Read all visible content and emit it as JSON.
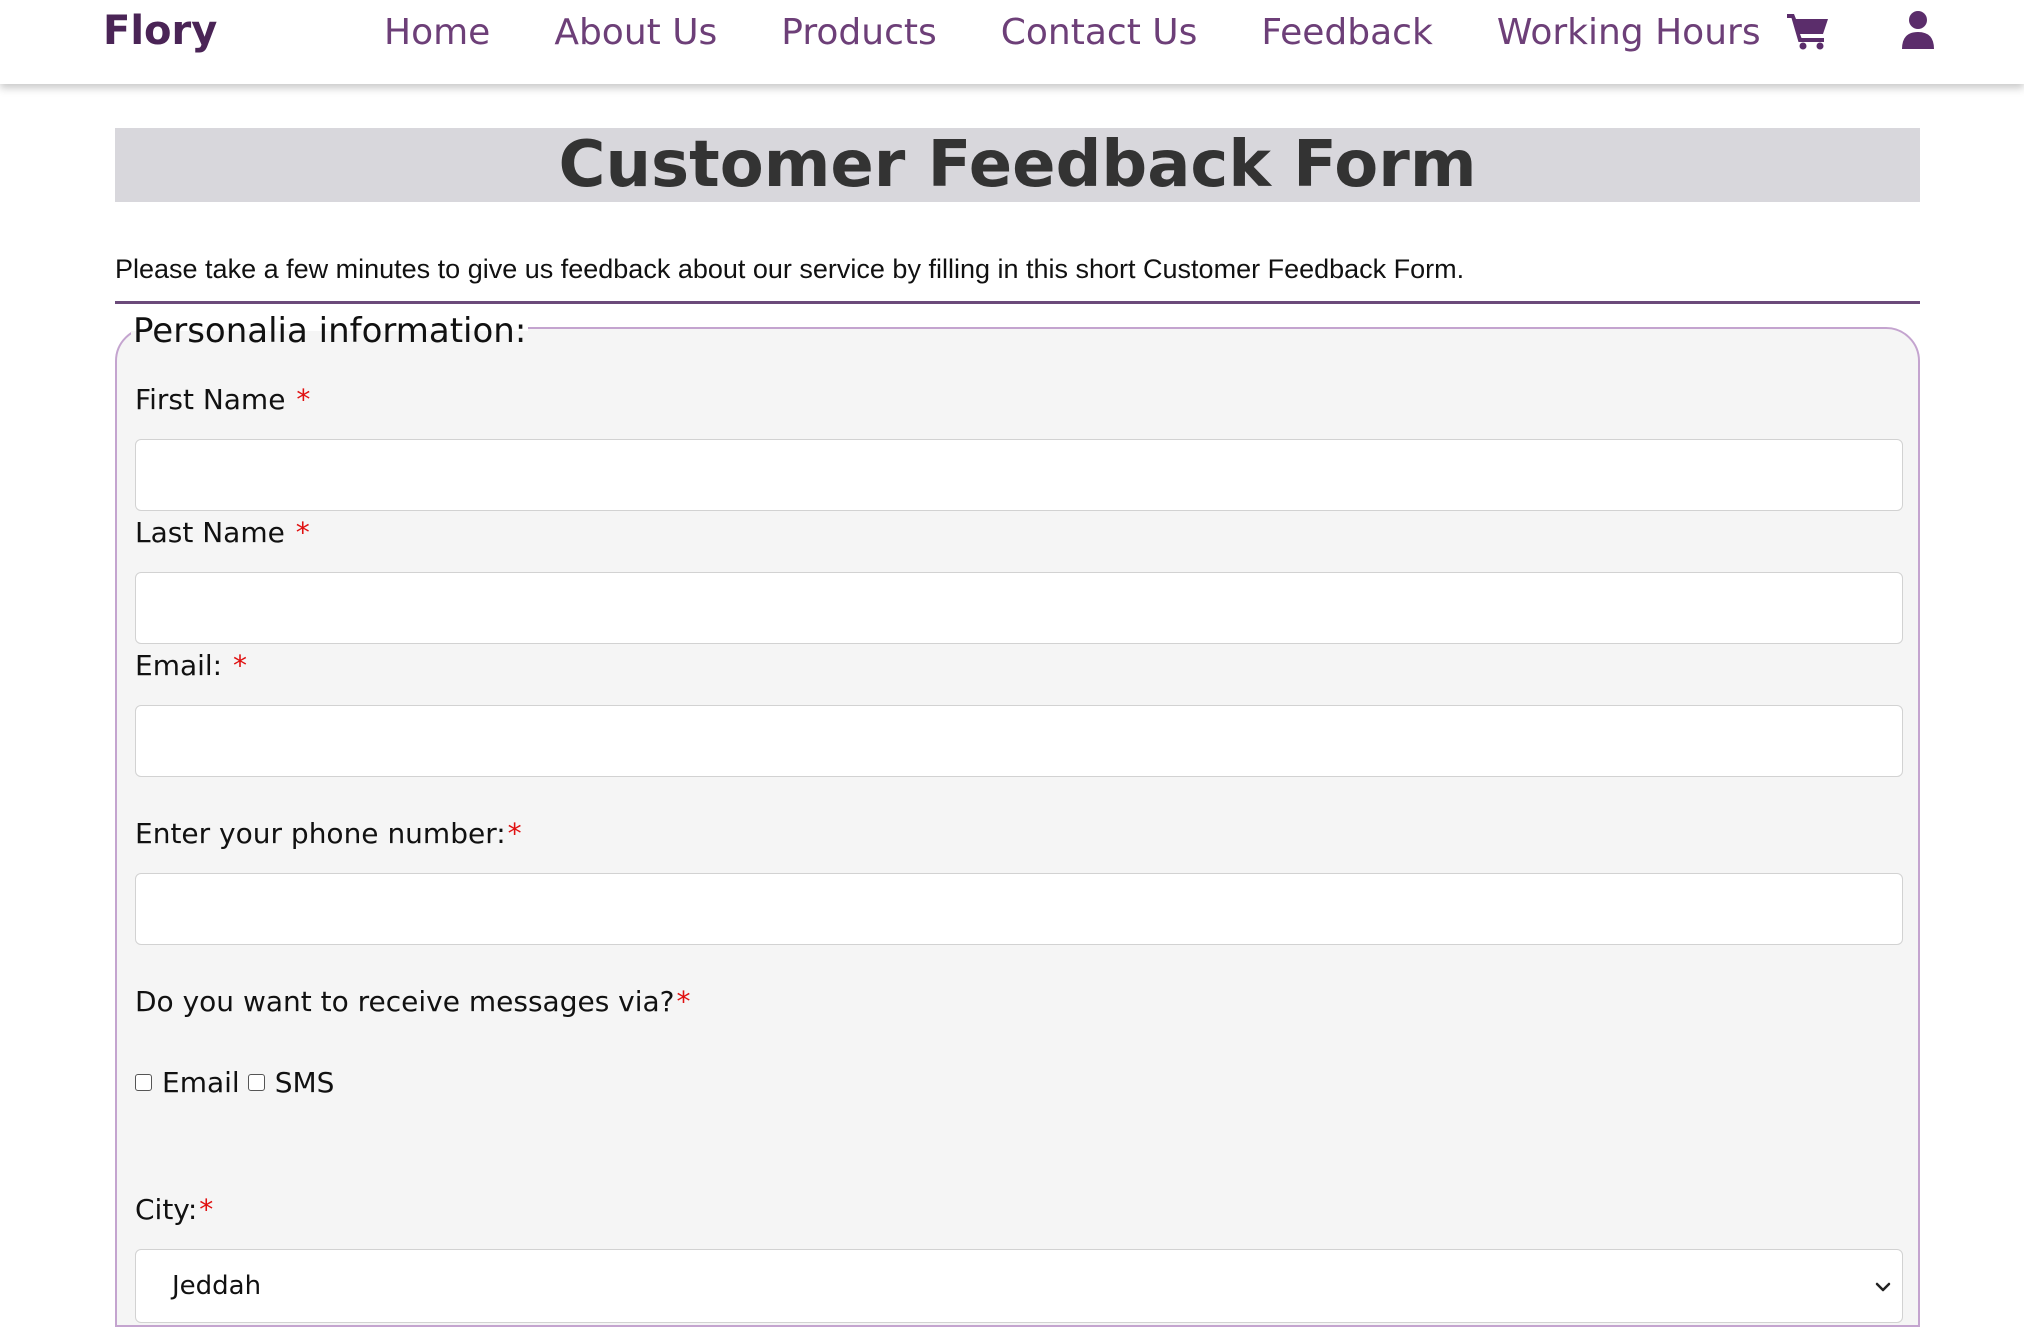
{
  "nav": {
    "brand": "Flory",
    "links": [
      "Home",
      "About Us",
      "Products",
      "Contact Us",
      "Feedback",
      "Working Hours"
    ],
    "icons": [
      "cart-icon",
      "user-icon"
    ]
  },
  "form": {
    "title": "Customer Feedback Form",
    "intro": "Please take a few minutes to give us feedback about our service by filling in this short Customer Feedback Form.",
    "legend": "Personalia information:",
    "required_marker": "*",
    "fields": {
      "first_name": {
        "label": "First Name",
        "value": ""
      },
      "last_name": {
        "label": "Last Name",
        "value": ""
      },
      "email": {
        "label": "Email:",
        "value": ""
      },
      "phone": {
        "label": "Enter your phone number:",
        "value": ""
      }
    },
    "messages": {
      "label": "Do you want to receive messages via?",
      "options": [
        {
          "label": "Email",
          "checked": false
        },
        {
          "label": "SMS",
          "checked": false
        }
      ]
    },
    "city": {
      "label": "City:",
      "selected": "Jeddah"
    }
  },
  "colors": {
    "brand": "#4a2456",
    "nav_link": "#6d3f78",
    "title_bar": "#d8d7dc",
    "divider": "#6b4a7a",
    "fieldset_border": "#c4a4cf",
    "required": "#e01010"
  }
}
